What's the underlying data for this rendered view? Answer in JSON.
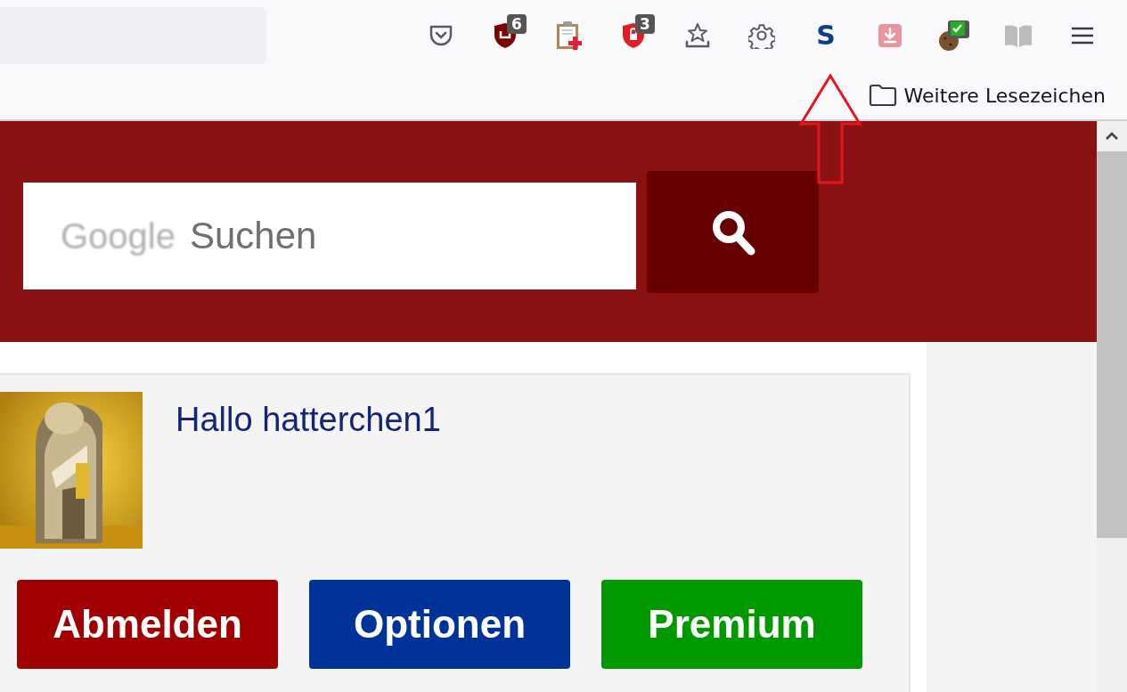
{
  "toolbar": {
    "buttons": [
      {
        "kind": "pocket"
      },
      {
        "kind": "shield-dark",
        "badge": "6"
      },
      {
        "kind": "clipboard"
      },
      {
        "kind": "shield-red",
        "badge": "3"
      },
      {
        "kind": "star-tray"
      },
      {
        "kind": "settings"
      },
      {
        "kind": "letter",
        "label": "S"
      },
      {
        "kind": "download"
      },
      {
        "kind": "cookie"
      },
      {
        "kind": "book"
      },
      {
        "kind": "menu"
      }
    ]
  },
  "bookmarks_bar": {
    "folder": "Weitere Lesezeichen"
  },
  "header": {
    "search": {
      "logo": "Google",
      "placeholder": "Suchen"
    }
  },
  "user_panel": {
    "greeting": "Hallo hatterchen1",
    "buttons": [
      {
        "label": "Abmelden",
        "color": "#a00000"
      },
      {
        "label": "Optionen",
        "color": "#003399"
      },
      {
        "label": "Premium",
        "color": "#009900"
      }
    ]
  }
}
